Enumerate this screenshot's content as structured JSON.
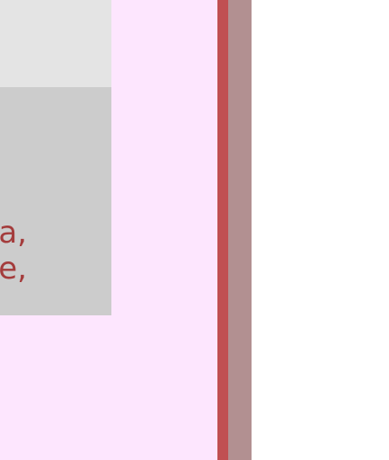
{
  "card": {
    "text_lines": [
      "a,",
      "e,"
    ]
  },
  "colors": {
    "panel_bg": "#fde6fe",
    "card_top_bg": "#e4e4e4",
    "card_body_bg": "#cccccc",
    "text_color": "#a43c3c",
    "divider_red": "#c05052",
    "divider_mauve": "#b29091",
    "right_bg": "#ffffff"
  }
}
